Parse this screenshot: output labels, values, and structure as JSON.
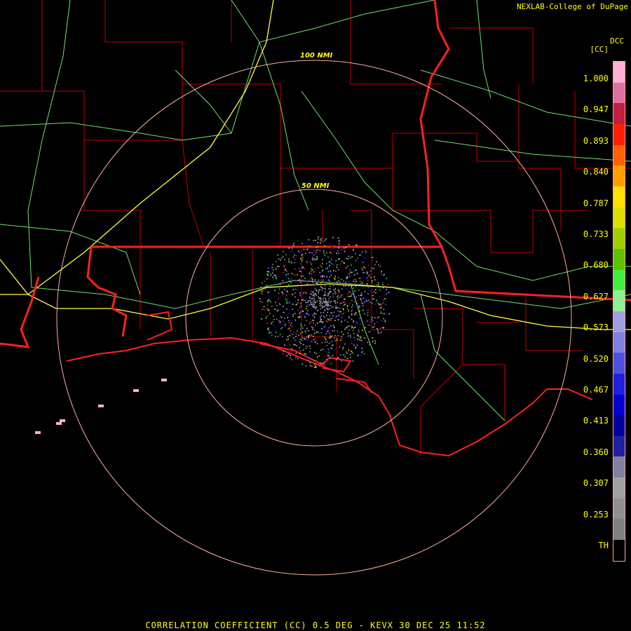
{
  "header": {
    "credit": "NEXLAB-College of DuPage",
    "site_code": "DCC",
    "unit": "[CC]"
  },
  "rings": {
    "inner_label": "50 NMI",
    "outer_label": "100 NMI"
  },
  "legend": {
    "ticks": [
      "1.000",
      "0.947",
      "0.893",
      "0.840",
      "0.787",
      "0.733",
      "0.680",
      "0.627",
      "0.573",
      "0.520",
      "0.467",
      "0.413",
      "0.360",
      "0.307",
      "0.253",
      "TH"
    ],
    "colors": [
      "#ffb0d0",
      "#e070a0",
      "#c02040",
      "#ff2000",
      "#ff6000",
      "#ffa000",
      "#ffe000",
      "#e0e000",
      "#a0d000",
      "#60c000",
      "#40f040",
      "#90f090",
      "#a0a0e0",
      "#8080e0",
      "#5050e0",
      "#2020e0",
      "#0000d0",
      "#0000a0",
      "#2020a0",
      "#8080a0",
      "#a0a0a0",
      "#909090",
      "#808080",
      "#000000"
    ]
  },
  "footer": {
    "product": "CORRELATION COEFFICIENT (CC) 0.5 DEG - KEVX 30 DEC 25 11:52"
  },
  "colors": {
    "state_border": "#ff2020",
    "county_border": "#c00000",
    "highway": "#80ff80",
    "interstate": "#ffff40",
    "range_ring": "#ffb0a0",
    "text": "#ffff00"
  }
}
